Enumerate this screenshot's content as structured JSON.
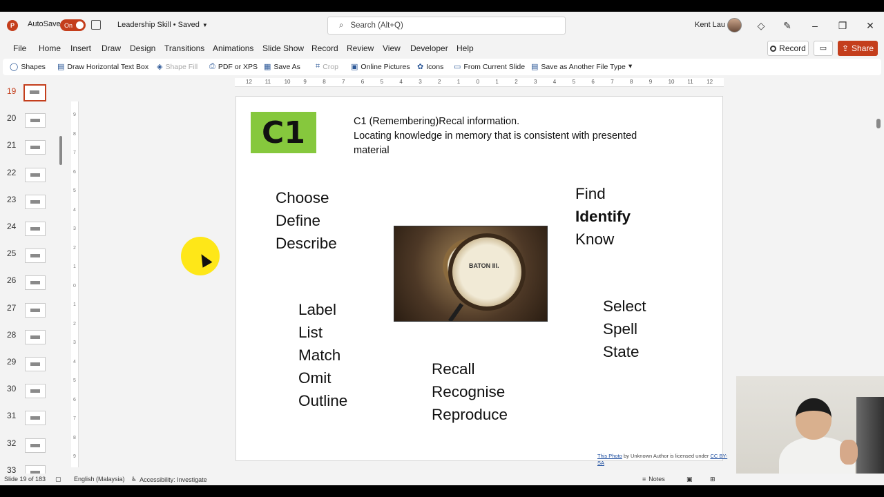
{
  "titlebar": {
    "autosave_label": "AutoSave",
    "autosave_state": "On",
    "doc_title": "Leadership Skill • Saved",
    "search_placeholder": "Search (Alt+Q)",
    "user_name": "Kent Lau"
  },
  "menu": [
    "File",
    "Home",
    "Insert",
    "Draw",
    "Design",
    "Transitions",
    "Animations",
    "Slide Show",
    "Record",
    "Review",
    "View",
    "Developer",
    "Help"
  ],
  "menu_right": {
    "record": "Record",
    "share": "Share"
  },
  "toolbar": [
    {
      "label": "Shapes",
      "icon": "shapes-icon",
      "disabled": false
    },
    {
      "label": "Draw Horizontal Text Box",
      "icon": "textbox-icon",
      "disabled": false
    },
    {
      "label": "Shape Fill",
      "icon": "fill-icon",
      "disabled": true
    },
    {
      "label": "PDF or XPS",
      "icon": "pdf-icon",
      "disabled": false
    },
    {
      "label": "Save As",
      "icon": "save-as-icon",
      "disabled": false
    },
    {
      "label": "Crop",
      "icon": "crop-icon",
      "disabled": true
    },
    {
      "label": "Online Pictures",
      "icon": "picture-icon",
      "disabled": false
    },
    {
      "label": "Icons",
      "icon": "icons-icon",
      "disabled": false
    },
    {
      "label": "From Current Slide",
      "icon": "slideshow-icon",
      "disabled": false
    },
    {
      "label": "Save as Another File Type",
      "icon": "file-type-icon",
      "disabled": false
    }
  ],
  "thumbnails": [
    "19",
    "20",
    "21",
    "22",
    "23",
    "24",
    "25",
    "26",
    "27",
    "28",
    "29",
    "30",
    "31",
    "32",
    "33"
  ],
  "active_thumbnail": "19",
  "hruler_ticks": [
    "12",
    "11",
    "10",
    "9",
    "8",
    "7",
    "6",
    "5",
    "4",
    "3",
    "2",
    "1",
    "0",
    "1",
    "2",
    "3",
    "4",
    "5",
    "6",
    "7",
    "8",
    "9",
    "10",
    "11",
    "12"
  ],
  "vruler_ticks": [
    "9",
    "8",
    "7",
    "6",
    "5",
    "4",
    "3",
    "2",
    "1",
    "0",
    "1",
    "2",
    "3",
    "4",
    "5",
    "6",
    "7",
    "8",
    "9"
  ],
  "slide": {
    "badge": "C1",
    "heading_line1": "C1 (Remembering)Recal information.",
    "heading_line2": "Locating knowledge in memory that is consistent with presented material",
    "group_top_left": [
      "Choose",
      "Define",
      "Describe"
    ],
    "group_top_right": [
      "Find",
      "Identify",
      "Know"
    ],
    "group_bottom_left": [
      "Label",
      "List",
      "Match",
      "Omit",
      "Outline"
    ],
    "group_bottom_right": [
      "Select",
      "Spell",
      "State"
    ],
    "group_bottom_center": [
      "Recall",
      "Recognise",
      "Reproduce"
    ],
    "photo_text": "BATON III.",
    "attribution_link": "This Photo",
    "attribution_mid": " by Unknown Author is licensed under ",
    "attribution_license": "CC BY-SA"
  },
  "status": {
    "slide_counter": "Slide 19 of 183",
    "language": "English (Malaysia)",
    "accessibility": "Accessibility: Investigate",
    "notes": "Notes"
  },
  "colors": {
    "accent": "#c43e1c",
    "badge_green": "#86c83d"
  }
}
